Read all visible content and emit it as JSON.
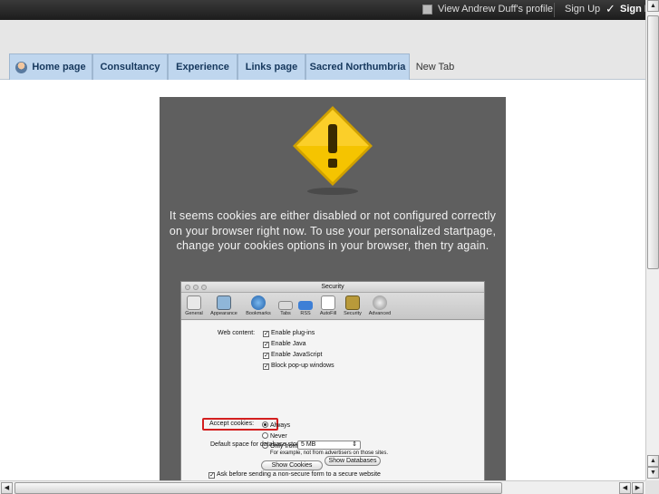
{
  "topbar": {
    "profile_label": "View Andrew Duff's profile",
    "signup_label": "Sign Up",
    "signin_label": "Sign In"
  },
  "tabs": [
    {
      "label": "Home page",
      "icon": "user-icon"
    },
    {
      "label": "Consultancy"
    },
    {
      "label": "Experience"
    },
    {
      "label": "Links page"
    },
    {
      "label": "Sacred Northumbria"
    },
    {
      "label": "New Tab"
    }
  ],
  "content": {
    "message": "It seems cookies are either disabled or not configured correctly on your browser right now. To use your personalized startpage, change your cookies options in your browser, then try again."
  },
  "prefs_window": {
    "title": "Security",
    "toolbar": [
      "General",
      "Appearance",
      "Bookmarks",
      "Tabs",
      "RSS",
      "AutoFill",
      "Security",
      "Advanced"
    ],
    "web_content_label": "Web content:",
    "web_content_options": [
      "Enable plug-ins",
      "Enable Java",
      "Enable JavaScript",
      "Block pop-up windows"
    ],
    "accept_cookies_label": "Accept cookies:",
    "cookie_options": [
      "Always",
      "Never",
      "Only from sites you navigate to"
    ],
    "cookie_note": "For example, not from advertisers on those sites.",
    "show_cookies": "Show Cookies",
    "db_label": "Default space for database storage:",
    "db_value": "5 MB",
    "show_databases": "Show Databases",
    "ask_secure": "Ask before sending a non-secure form to a secure website"
  },
  "colors": {
    "tab_bg": "#bfd6ee",
    "tab_text": "#15375c",
    "panel_bg": "#5f5f5f",
    "warning_yellow": "#f5c400",
    "highlight_red": "#d31f1f"
  }
}
